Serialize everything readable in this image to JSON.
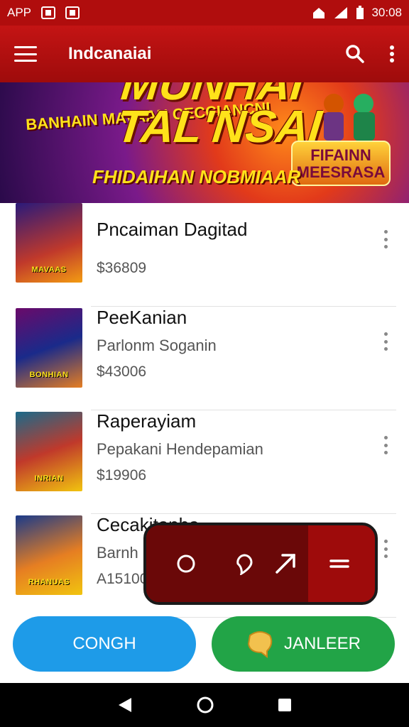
{
  "status_bar": {
    "app_label": "APP",
    "time": "30:08"
  },
  "app_bar": {
    "title": "Indcanaiai"
  },
  "banner": {
    "headline": "MUNHAI TAL'NSAI",
    "small_text": "BANHAIN MAVAAN CECCIANCNI",
    "subline": "FHIDAIHAN NOBMIAAR",
    "badge": "FIFAINN MEESRASA"
  },
  "products": [
    {
      "name": "Pncaiman Dagitad",
      "subtitle": "",
      "price": "$36809",
      "thumb_label": "MAVAAS",
      "thumb_bg": "linear-gradient(160deg,#2a1a7a,#c0392b 60%,#f39c12)"
    },
    {
      "name": "PeeKanian",
      "subtitle": "Parlonm Soganin",
      "price": "$43006",
      "thumb_bg": "linear-gradient(160deg,#6a0a6a,#1a2a8a 50%,#e67e22)",
      "thumb_label": "BONHIAN"
    },
    {
      "name": "Raperayiam",
      "subtitle": "Pepakani Hendepamian",
      "price": "$19906",
      "thumb_bg": "linear-gradient(160deg,#1a6a8a,#c0392b 50%,#f1c40f)",
      "thumb_label": "INRIAN"
    },
    {
      "name": "Cecakitanha",
      "subtitle": "Barnh",
      "price": "A15100",
      "thumb_bg": "linear-gradient(160deg,#1a3a8a,#e67e22 55%,#f1c40f)",
      "thumb_label": "RHANUAS"
    }
  ],
  "bottom_buttons": {
    "left": "CONGH",
    "right": "JANLEER"
  },
  "colors": {
    "primary": "#b00d0d",
    "left_button": "#1e9be8",
    "right_button": "#22a447"
  }
}
